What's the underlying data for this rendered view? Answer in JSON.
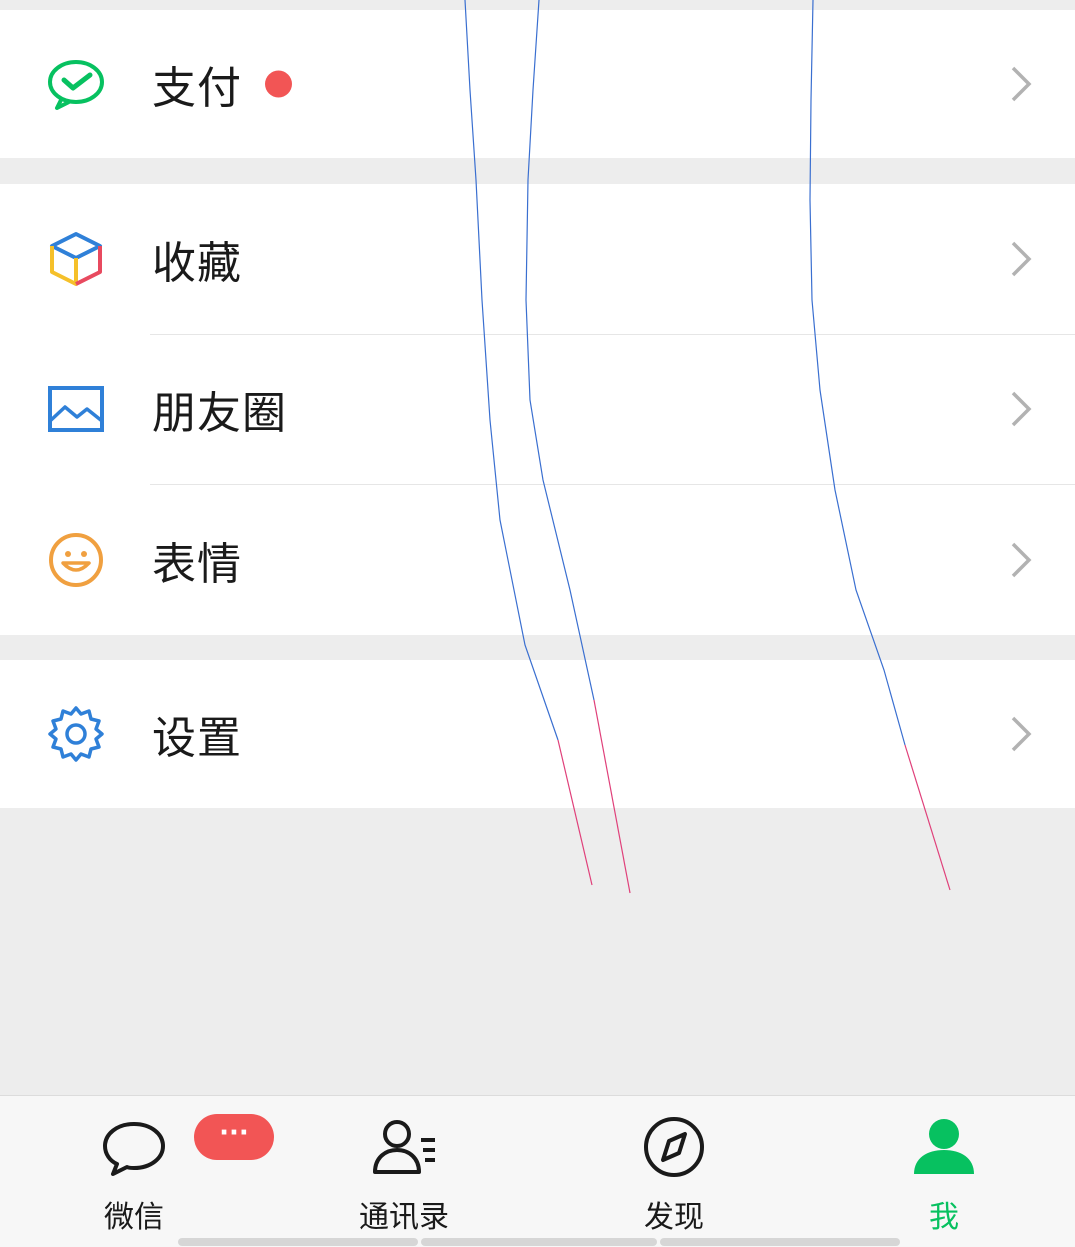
{
  "menu": {
    "pay": {
      "label": "支付",
      "icon": "wechat-pay-icon",
      "has_red_dot": true,
      "icon_color": "#07c160"
    },
    "favorites": {
      "label": "收藏",
      "icon": "cube-icon"
    },
    "moments": {
      "label": "朋友圈",
      "icon": "picture-icon",
      "icon_color": "#2f80d8"
    },
    "stickers": {
      "label": "表情",
      "icon": "smiley-icon",
      "icon_color": "#f0a040"
    },
    "settings": {
      "label": "设置",
      "icon": "gear-icon",
      "icon_color": "#2f80d8"
    }
  },
  "tabbar": {
    "tabs": [
      {
        "label": "微信",
        "icon": "chat-bubble-icon",
        "badge": "···"
      },
      {
        "label": "通讯录",
        "icon": "contacts-icon"
      },
      {
        "label": "发现",
        "icon": "compass-icon"
      },
      {
        "label": "我",
        "icon": "person-icon",
        "active": true
      }
    ],
    "active_color": "#07c160"
  },
  "colors": {
    "badge_red": "#f25555",
    "background": "#ededed"
  }
}
